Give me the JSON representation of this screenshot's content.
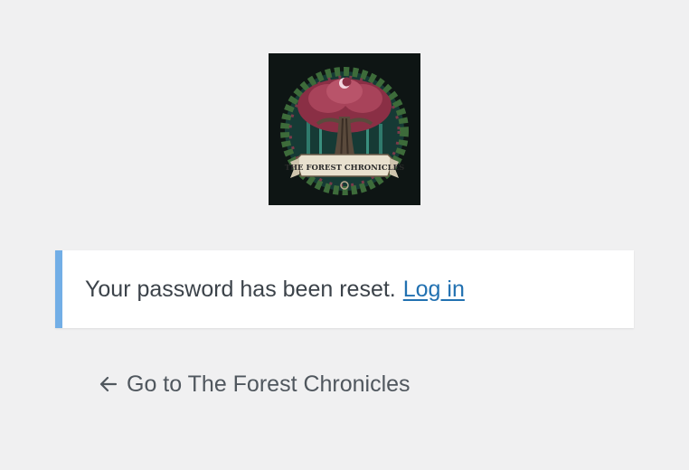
{
  "logo": {
    "alt_icon": "forest-tree-emblem",
    "banner_text": "THE FOREST CHRONICLES"
  },
  "notice": {
    "message": "Your password has been reset.",
    "link_label": "Log in",
    "accent_color": "#72aee6",
    "link_color": "#2271b1"
  },
  "back_link": {
    "arrow": "←",
    "label": "Go to The Forest Chronicles"
  }
}
